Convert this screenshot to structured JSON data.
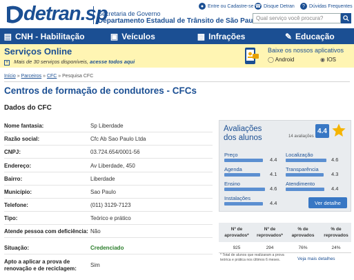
{
  "header": {
    "logo_text": "detran.sp",
    "gov_line1": "Secretaria de Governo",
    "gov_line2": "Departamento Estadual de Trânsito de São Paulo",
    "links": [
      "Entre ou Cadastre-se",
      "Disque Detran",
      "Dúvidas Frequentes"
    ],
    "search_placeholder": "Qual serviço você procura?"
  },
  "nav": {
    "items": [
      "CNH - Habilitação",
      "Veículos",
      "Infrações",
      "Educação"
    ]
  },
  "services": {
    "title": "Serviços Online",
    "subtitle_prefix": "Mais de 30 serviços disponíveis,",
    "subtitle_link": "acesse todos aqui",
    "apps_title": "Baixe os nossos aplicativos",
    "android": "Android",
    "ios": "IOS"
  },
  "breadcrumb": {
    "items": [
      "Início",
      "Parceiros",
      "CFC",
      "Pesquisa CFC"
    ],
    "sep": "»"
  },
  "page_title": "Centros de formação de condutores - CFCs",
  "section_title": "Dados do CFC",
  "rows": [
    {
      "label": "Nome fantasia:",
      "value": "Sp Liberdade"
    },
    {
      "label": "Razão social:",
      "value": "Cfc Ab Sao Paulo Ltda"
    },
    {
      "label": "CNPJ:",
      "value": "03.724.654/0001-56"
    },
    {
      "label": "Endereço:",
      "value": "Av Liberdade, 450"
    },
    {
      "label": "Bairro:",
      "value": "Liberdade"
    },
    {
      "label": "Município:",
      "value": "Sao Paulo"
    },
    {
      "label": "Telefone:",
      "value": "(011) 3129-7123"
    },
    {
      "label": "Tipo:",
      "value": "Teórico e prático"
    },
    {
      "label": "Atende pessoa com deficiência:",
      "value": "Não"
    },
    {
      "label": "Situação:",
      "value": "Credenciado"
    },
    {
      "label": "Apto a aplicar a prova de renovação e de reciclagem:",
      "value": "Sim"
    }
  ],
  "rating": {
    "title_line1": "Avaliações",
    "title_line2": "dos alunos",
    "count_text": "14 avaliações",
    "score": "4.4",
    "criteria": [
      {
        "name": "Preço",
        "value": "4.4",
        "fill": 0.88
      },
      {
        "name": "Localização",
        "value": "4.6",
        "fill": 0.92
      },
      {
        "name": "Agenda",
        "value": "4.1",
        "fill": 0.82
      },
      {
        "name": "Transparência",
        "value": "4.3",
        "fill": 0.86
      },
      {
        "name": "Ensino",
        "value": "4.6",
        "fill": 0.92
      },
      {
        "name": "Atendimento",
        "value": "4.4",
        "fill": 0.88
      },
      {
        "name": "Instalações",
        "value": "4.4",
        "fill": 0.88
      }
    ],
    "detail_button": "Ver detalhe",
    "accent": "#3877c4"
  },
  "stats": {
    "headers": [
      "Nº de aprovados*",
      "Nº de reprovados*",
      "% de aprovados",
      "% de reprovados"
    ],
    "values": [
      "925",
      "294",
      "76%",
      "24%"
    ],
    "note": "* Total de alunos que realizaram a prova teórica e prática nos últimos 6 meses.",
    "link": "Veja mais detalhes"
  }
}
